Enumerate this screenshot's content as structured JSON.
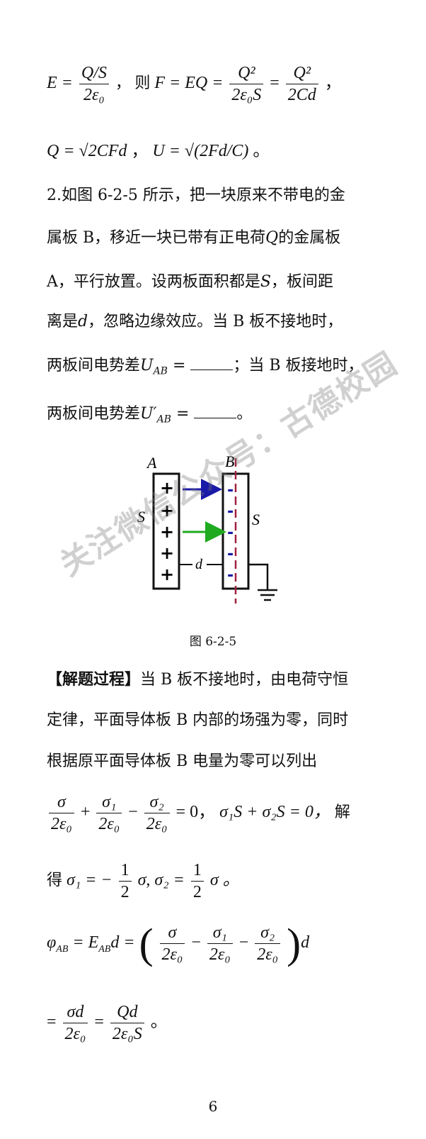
{
  "formulas": {
    "line1": {
      "e_lhs": "E =",
      "e_num": "Q/S",
      "e_den": "2ε₀",
      "then": "，  则",
      "f_lhs": "F = EQ =",
      "f1_num": "Q²",
      "f1_den": "2ε₀S",
      "eq": "=",
      "f2_num": "Q²",
      "f2_den": "2Cd",
      "end": "，"
    },
    "line2": {
      "q": "Q = √2CFd",
      "sep": "，",
      "u": "U = √(2Fd/C)",
      "end": "。"
    }
  },
  "problem": {
    "l1": "2.如图  6-2-5  所示，把一块原来不带电的金",
    "l2a": "属板 B，移近一块已带有正电荷",
    "l2q": "Q",
    "l2b": "的金属板",
    "l3a": "A，平行放置。设两板面积都是",
    "l3s": "S",
    "l3b": "，板间距",
    "l4a": "离是",
    "l4d": "d",
    "l4b": "，忽略边缘效应。当 B 板不接地时，",
    "l5a": "两板间电势差",
    "l5u": "U",
    "l5sub": "AB",
    "l5eq": "=",
    "l5b": "；当 B 板接地时，",
    "l6a": "两板间电势差",
    "l6u": "U′",
    "l6sub": "AB",
    "l6eq": "=",
    "l6b": "。"
  },
  "figure": {
    "label_a": "A",
    "label_b": "B",
    "label_s_left": "S",
    "label_s_right": "S",
    "label_d": "d",
    "plus_signs": [
      "+",
      "+",
      "+",
      "+",
      "+"
    ],
    "minus_signs": [
      "-",
      "-",
      "-",
      "-",
      "-"
    ],
    "caption": "图 6-2-5",
    "colors": {
      "arrow_top": "#1a1aa8",
      "arrow_mid": "#1faa1f",
      "dashed_line": "#a02040",
      "minus": "#1a1aa8"
    }
  },
  "solution": {
    "header": "【解题过程】",
    "s1": "当 B 板不接地时，由电荷守恒",
    "s2": "定律，平面导体板 B 内部的场强为零，同时",
    "s3": "根据原平面导体板   B   电量为零可以列出",
    "eq1": {
      "t1_num": "σ",
      "t1_den": "2ε₀",
      "plus": "+",
      "t2_num": "σ₁",
      "t2_den": "2ε₀",
      "minus": "−",
      "t3_num": "σ₂",
      "t3_den": "2ε₀",
      "rhs": "= 0，",
      "cond": "σ₁S + σ₂S = 0，",
      "tail": "解"
    },
    "eq2": {
      "pre": "得",
      "a": "σ₁ = −",
      "h1_num": "1",
      "h1_den": "2",
      "b": "σ, σ₂ =",
      "h2_num": "1",
      "h2_den": "2",
      "c": "σ 。"
    },
    "eq3": {
      "lhs": "φ",
      "lhs_sub": "AB",
      "mid": "= E",
      "mid_sub": "AB",
      "mid2": "d =",
      "t1_num": "σ",
      "t1_den": "2ε₀",
      "m1": "−",
      "t2_num": "σ₁",
      "t2_den": "2ε₀",
      "m2": "−",
      "t3_num": "σ₂",
      "t3_den": "2ε₀",
      "tail": "d"
    },
    "eq4": {
      "eq": "=",
      "f1_num": "σd",
      "f1_den": "2ε₀",
      "eq2": "=",
      "f2_num": "Qd",
      "f2_den": "2ε₀S",
      "end": "。"
    }
  },
  "watermark": "关注微信公众号：古德校园",
  "page_number": "6"
}
